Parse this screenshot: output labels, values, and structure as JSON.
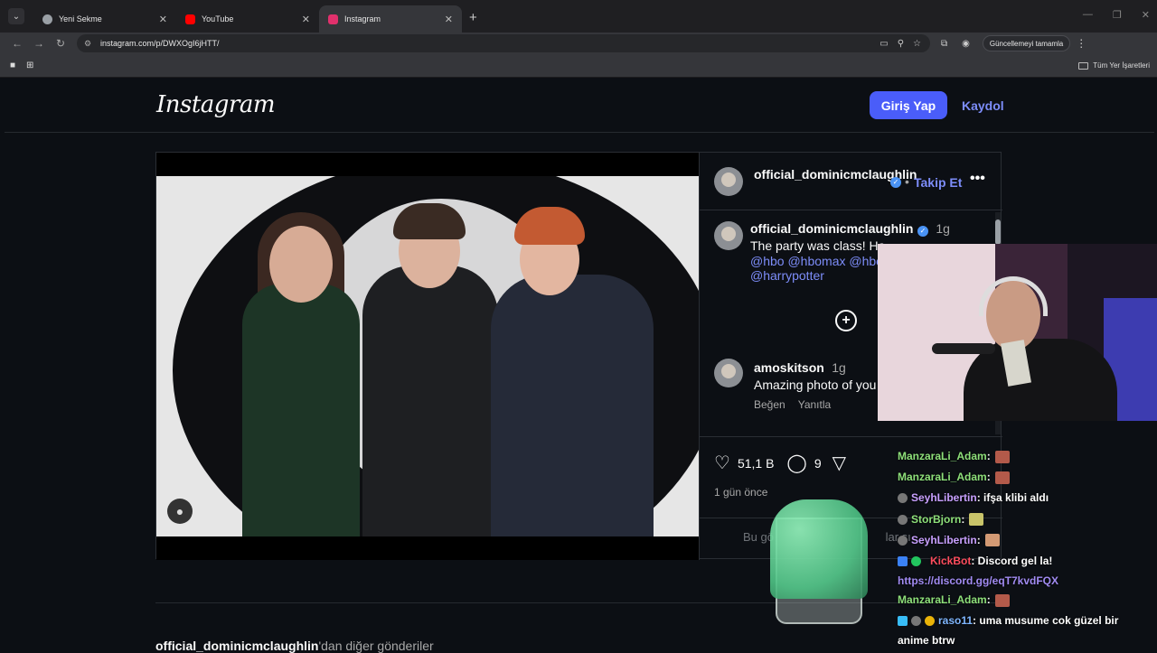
{
  "browser": {
    "tabs": [
      {
        "label": "Yeni Sekme",
        "icon": "chrome-icon",
        "color": "#9aa0a6"
      },
      {
        "label": "YouTube",
        "icon": "youtube-icon",
        "color": "#ff0000"
      },
      {
        "label": "Instagram",
        "icon": "instagram-icon",
        "color": "#e1306c"
      }
    ],
    "url": "instagram.com/p/DWXOgI6jHTT/",
    "update_label": "Güncellemeyi tamamla",
    "bookmarks_label": "Tüm Yer İşaretleri"
  },
  "instagram": {
    "logo": "Instagram",
    "login_label": "Giriş Yap",
    "signup_label": "Kaydol",
    "post": {
      "owner": "official_dominicmclaughlin",
      "follow_label": "Takip Et",
      "caption_user": "official_dominicmclaughlin",
      "caption_time": "1g",
      "caption_text": "The party was class! Ha",
      "mentions_line1": "@hbo @hbomax @hbo",
      "mentions_line2": "@harrypotter",
      "comment_user": "amoskitson",
      "comment_time": "1g",
      "comment_text": "Amazing photo of you",
      "like_label": "Beğen",
      "reply_label": "Yanıtla",
      "likes": "51,1 B",
      "comments": "9",
      "time_ago": "1 gün önce",
      "input_placeholder": "Bu gö",
      "input_placeholder_tail": "lar sı"
    },
    "more_posts_user": "official_dominicmclaughlin",
    "more_posts_suffix": "'dan diğer gönderiler"
  },
  "chat": {
    "lines": [
      {
        "user": "ManzaraLi_Adam",
        "text": " :",
        "user_color": "#8ee07a",
        "emote": "#b35a4a"
      },
      {
        "user": "ManzaraLi_Adam",
        "text": " :",
        "user_color": "#8ee07a",
        "emote": "#b35a4a"
      },
      {
        "user": "SeyhLibertin",
        "text": " : ifşa klibi aldı",
        "user_color": "#c8a0ff",
        "emote": ""
      },
      {
        "user": "StorBjorn",
        "text": " :",
        "user_color": "#8ee07a",
        "emote": "#c9c46a"
      },
      {
        "user": "SeyhLibertin",
        "text": " :",
        "user_color": "#c8a0ff",
        "emote": "#d39a74"
      },
      {
        "user": "KickBot",
        "text": " : Discord gel la!",
        "user_color": "#ff4d5e",
        "emote": ""
      }
    ],
    "link": "https://discord.gg/eqT7kvdFQX",
    "line_after_link": {
      "user": "ManzaraLi_Adam",
      "text": " :",
      "user_color": "#8ee07a",
      "emote": "#b35a4a"
    },
    "last_user": "raso11",
    "last_user_color": "#7fb6ff",
    "last_text": " : uma musume cok güzel bir",
    "last_text_2": "anime btrw"
  }
}
